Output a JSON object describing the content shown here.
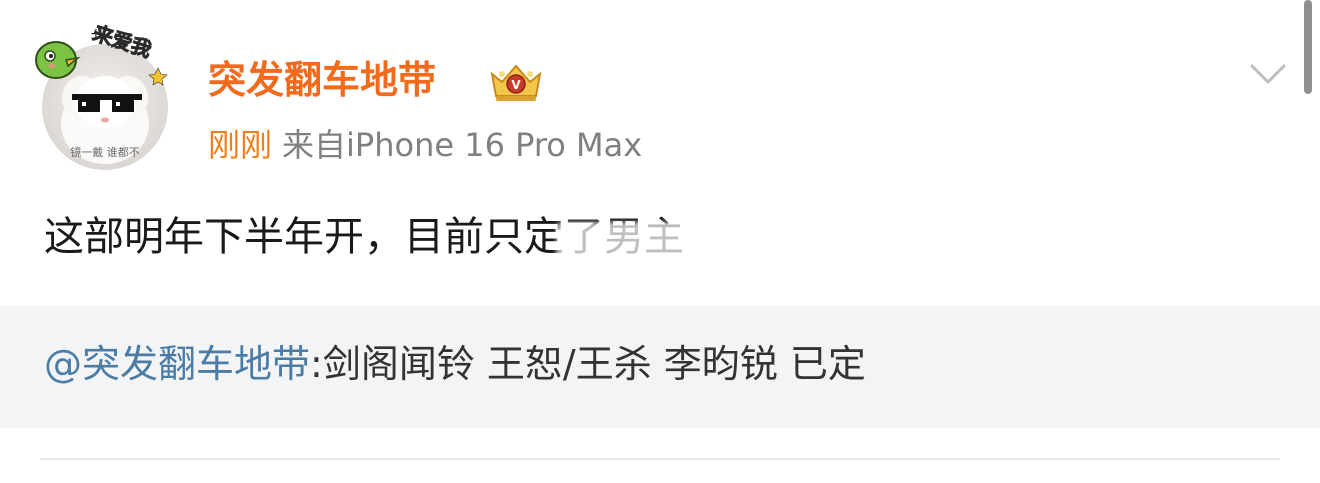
{
  "post": {
    "author_name": "突发翻车地带",
    "time": "刚刚",
    "source": "来自iPhone 16 Pro Max",
    "content_visible": "这部明年下半年开，目前只定了男主",
    "avatar_caption": "镜一戴 谁都不",
    "sticker_text": "来爱我"
  },
  "repost": {
    "mention": "@突发翻车地带",
    "text": ":剑阁闻铃 王恕/王杀 李昀锐 已定"
  },
  "colors": {
    "author": "#f26a1b",
    "time": "#f0801e",
    "meta": "#808080",
    "mention": "#4a7ca6",
    "repost_bg": "#f3f4f5"
  }
}
